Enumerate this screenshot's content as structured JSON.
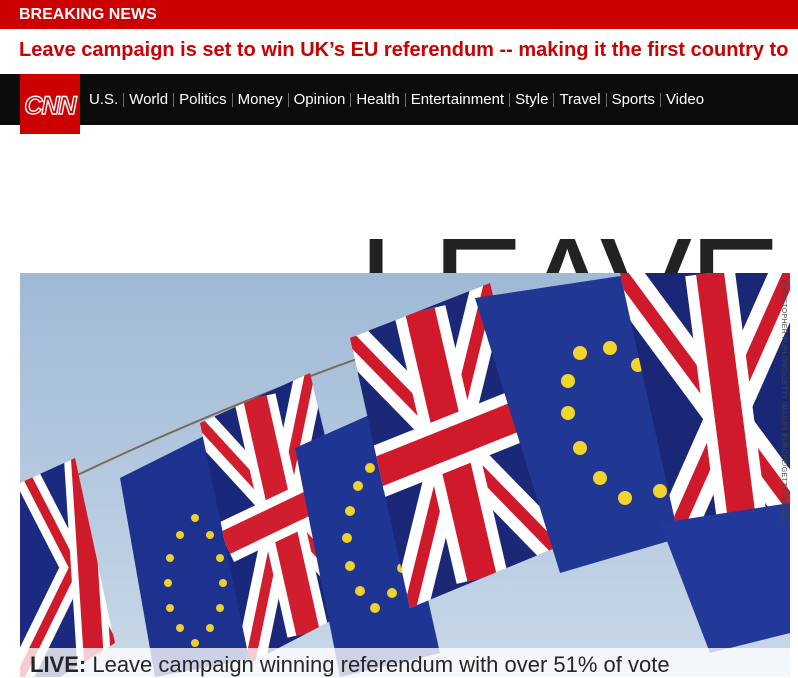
{
  "breaking": {
    "label": "BREAKING NEWS",
    "headline": "Leave campaign is set to win UK’s EU referendum -- making it the first country to"
  },
  "brand": {
    "logo_text": "CNN",
    "color": "#cc0000"
  },
  "nav": {
    "items": [
      {
        "label": "U.S."
      },
      {
        "label": "World"
      },
      {
        "label": "Politics"
      },
      {
        "label": "Money"
      },
      {
        "label": "Opinion"
      },
      {
        "label": "Health"
      },
      {
        "label": "Entertainment"
      },
      {
        "label": "Style"
      },
      {
        "label": "Travel"
      },
      {
        "label": "Sports"
      },
      {
        "label": "Video"
      }
    ]
  },
  "main": {
    "title": "LEAVE",
    "photo_credit": "CHRISTOPHER FURLONG/GETTY IMAGES EUROPE/GETTY IMAGES",
    "live_label": "LIVE:",
    "live_text": " Leave campaign winning referendum with over 51% of vote"
  },
  "colors": {
    "nav_bg": "#0c0c0c",
    "breaking_bg": "#cc0000",
    "headline_text": "#cc0000",
    "title_text": "#222222"
  }
}
